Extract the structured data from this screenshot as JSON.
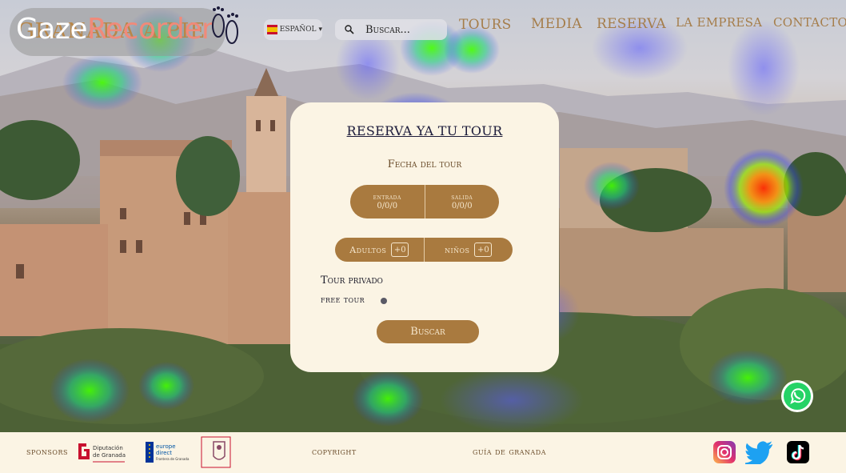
{
  "header": {
    "logo_under": "GRANADA A PIE",
    "logo_brand": "GazeRecorder",
    "language": {
      "label": "ESPAÑOL",
      "flag": "spain-flag-icon"
    },
    "search": {
      "placeholder": "Buscar..."
    },
    "nav": [
      {
        "label": "TOURS"
      },
      {
        "label": "MEDIA"
      },
      {
        "label": "RESERVA"
      },
      {
        "label": "LA EMPRESA"
      },
      {
        "label": "CONTACTO"
      }
    ]
  },
  "booking": {
    "title": "RESERVA YA TU TOUR",
    "date_heading": "Fecha del tour",
    "entrada": {
      "label": "entrada",
      "value": "0/0/0"
    },
    "salida": {
      "label": "salida",
      "value": "0/0/0"
    },
    "adultos": {
      "label": "Adultos",
      "value": "+0"
    },
    "ninos": {
      "label": "niños",
      "value": "+0"
    },
    "tour_privado": "Tour privado",
    "free_tour": "free tour",
    "button": "Buscar"
  },
  "footer": {
    "sponsors": "sponsors",
    "sponsor_logos": [
      "Diputación de Granada",
      "europe direct",
      "Ayuntamiento de Granada"
    ],
    "copyright": "copyright",
    "guia": "guía de granada",
    "social": [
      "instagram-icon",
      "twitter-icon",
      "tiktok-icon"
    ]
  },
  "colors": {
    "accent": "#a97a3f",
    "card": "#fbf4e4",
    "nav": "#a57d4a",
    "title": "#1c1b3a"
  }
}
